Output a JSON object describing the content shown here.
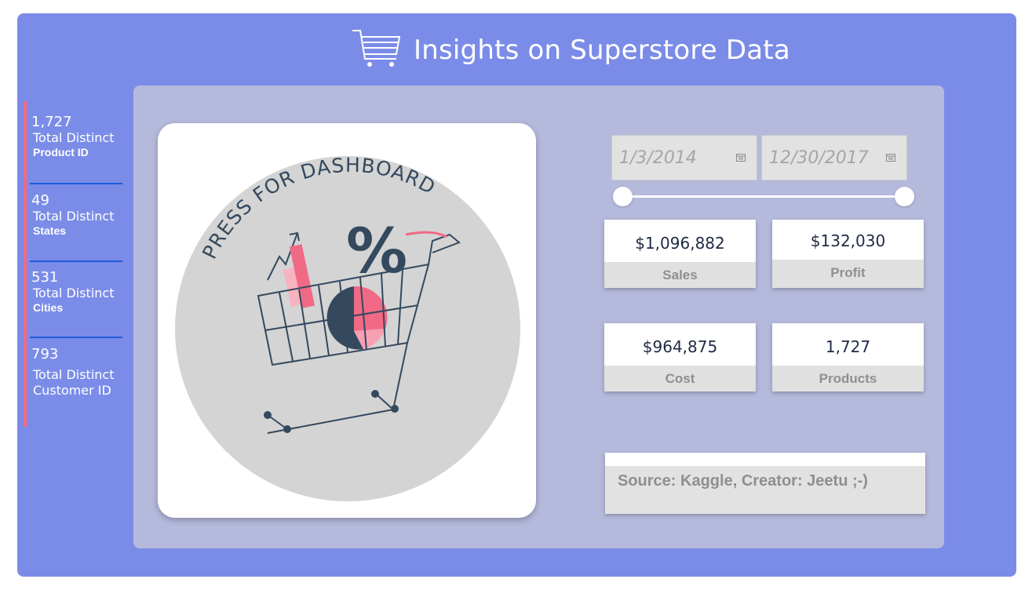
{
  "header": {
    "title": "Insights on Superstore Data",
    "icon": "shopping-cart-icon"
  },
  "stats": [
    {
      "value": "1,727",
      "label": "Total Distinct",
      "sublabel": "Product ID"
    },
    {
      "value": "49",
      "label": "Total Distinct",
      "sublabel": "States"
    },
    {
      "value": "531",
      "label": "Total Distinct",
      "sublabel": "Cities"
    },
    {
      "value": "793",
      "label": "Total Distinct",
      "sublabel": "Customer ID"
    }
  ],
  "image_button": {
    "text": "PRESS FOR DASHBOARD",
    "icon": "shopping-cart-chart-icon"
  },
  "date_range": {
    "start": "1/3/2014",
    "end": "12/30/2017"
  },
  "kpis": [
    {
      "value": "$1,096,882",
      "label": "Sales"
    },
    {
      "value": "$132,030",
      "label": "Profit"
    },
    {
      "value": "$964,875",
      "label": "Cost"
    },
    {
      "value": "1,727",
      "label": "Products"
    }
  ],
  "source": {
    "text": "Source: Kaggle, Creator: Jeetu ;-)"
  },
  "colors": {
    "background": "#7b8ce8",
    "panel": "#b5b9dc",
    "accent": "#f06a86",
    "dark": "#34495e"
  }
}
